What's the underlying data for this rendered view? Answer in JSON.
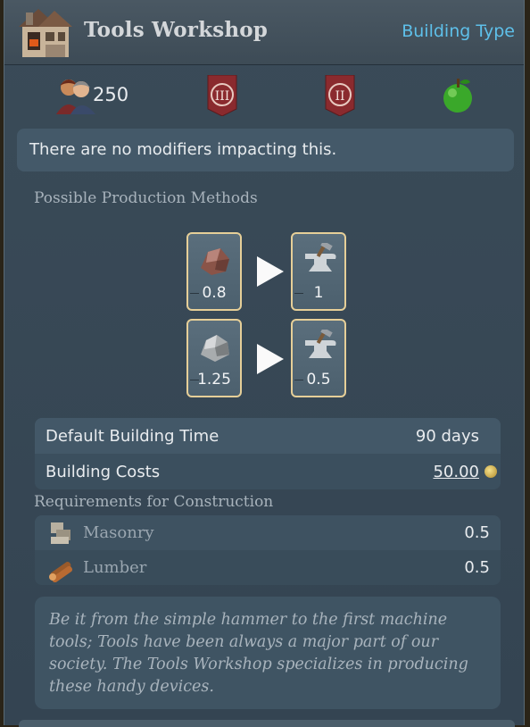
{
  "header": {
    "title": "Tools Workshop",
    "building_type_link": "Building Type",
    "icon": "workshop-building-icon"
  },
  "stats": {
    "population": "250",
    "population_icon": "population-icon",
    "banner1": "III",
    "banner2": "II",
    "apple_icon": "apple-icon"
  },
  "modifiers": {
    "text": "There are no modifiers impacting this."
  },
  "production": {
    "section_title": "Possible Production Methods",
    "methods": [
      {
        "input_icon": "iron-ore-icon",
        "input_value": "0.8",
        "output_icon": "anvil-icon",
        "output_value": "1"
      },
      {
        "input_icon": "stone-ore-icon",
        "input_value": "1.25",
        "output_icon": "anvil-icon",
        "output_value": "0.5"
      }
    ]
  },
  "building_info": {
    "time_label": "Default Building Time",
    "time_value": "90 days",
    "cost_label": "Building Costs",
    "cost_value": "50.00",
    "coin_icon": "coin-icon"
  },
  "requirements": {
    "section_title": "Requirements for Construction",
    "items": [
      {
        "icon": "masonry-icon",
        "label": "Masonry",
        "value": "0.5"
      },
      {
        "icon": "lumber-icon",
        "label": "Lumber",
        "value": "0.5"
      }
    ]
  },
  "description": {
    "text": "Be it from the simple hammer to the first machine tools; Tools have been always a major part of our society. The Tools Workshop specializes in producing these handy devices."
  },
  "colors": {
    "accent_link": "#5ec0ea",
    "card_border": "#e6cf98",
    "banner_red": "#8a2a2e"
  }
}
